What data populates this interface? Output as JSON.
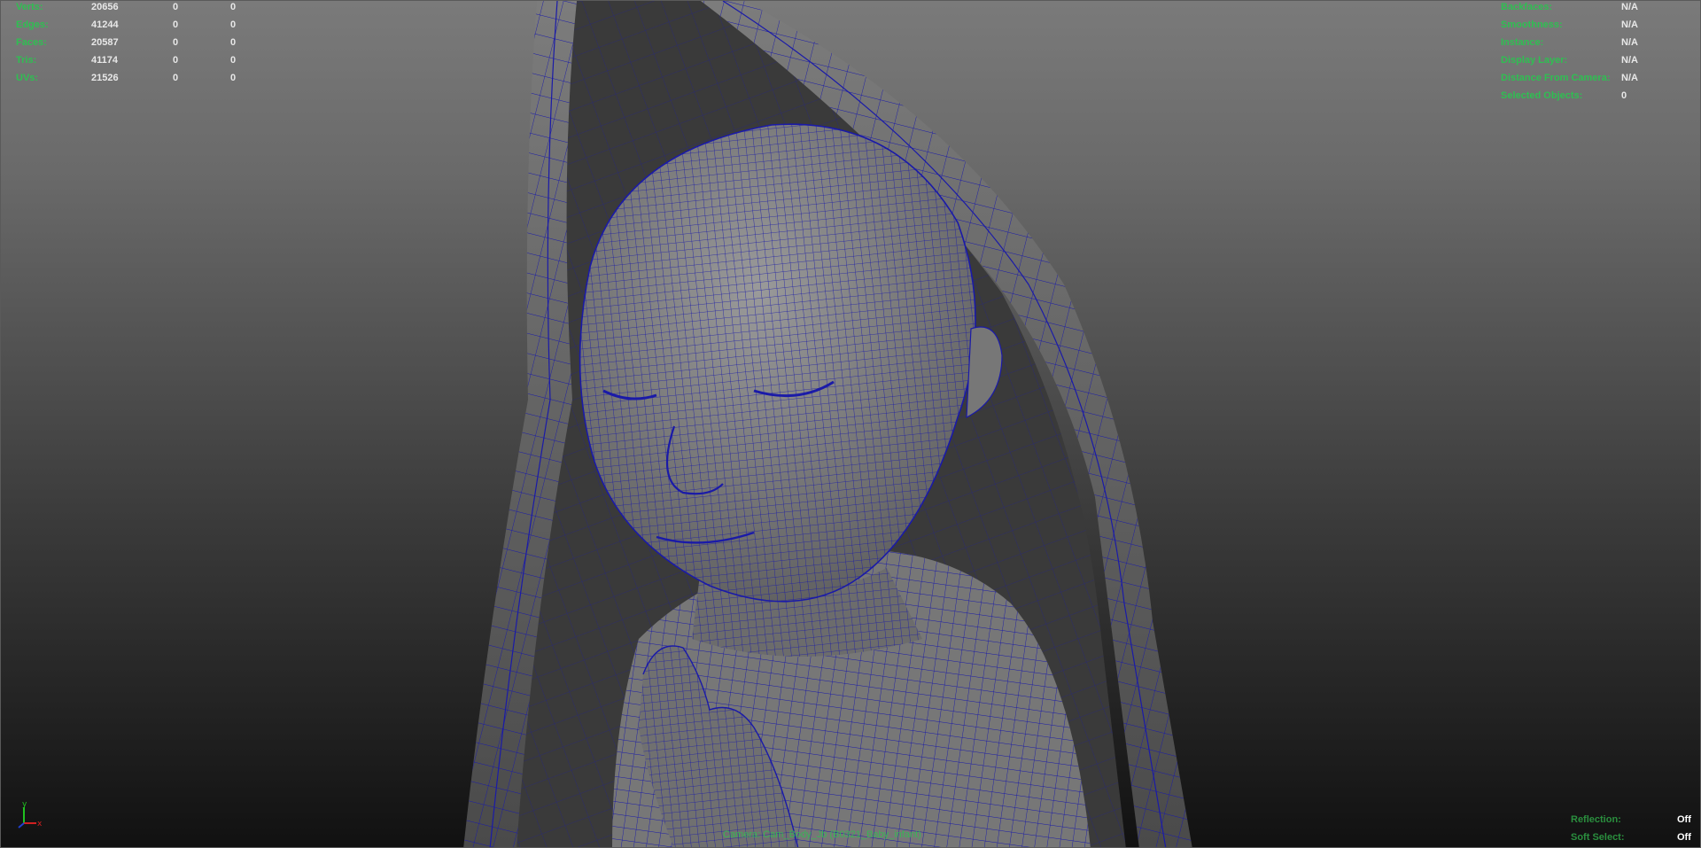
{
  "heads_up_left": {
    "rows": [
      {
        "label": "Verts:",
        "c1": "20656",
        "c2": "0",
        "c3": "0"
      },
      {
        "label": "Edges:",
        "c1": "41244",
        "c2": "0",
        "c3": "0"
      },
      {
        "label": "Faces:",
        "c1": "20587",
        "c2": "0",
        "c3": "0"
      },
      {
        "label": "Tris:",
        "c1": "41174",
        "c2": "0",
        "c3": "0"
      },
      {
        "label": "UVs:",
        "c1": "21526",
        "c2": "0",
        "c3": "0"
      }
    ]
  },
  "heads_up_right": {
    "rows": [
      {
        "label": "Backfaces:",
        "value": "N/A"
      },
      {
        "label": "Smoothness:",
        "value": "N/A"
      },
      {
        "label": "Instance:",
        "value": "N/A"
      },
      {
        "label": "Display Layer:",
        "value": "N/A"
      },
      {
        "label": "Distance From Camera:",
        "value": "N/A"
      },
      {
        "label": "Selected Objects:",
        "value": "0"
      }
    ]
  },
  "heads_up_bottom_right": {
    "rows": [
      {
        "label": "Reflection:",
        "value": "Off"
      },
      {
        "label": "Soft Select:",
        "value": "Off"
      }
    ]
  },
  "camera_label": "Camera: Cam_Body_Jb (B0321_Baby_infant)",
  "axis": {
    "x": "x",
    "y": "y",
    "z": "z"
  },
  "colors": {
    "hud_label": "#2fbf52",
    "hud_value": "#e8e8e8",
    "wireframe": "#1a1aa8",
    "mesh_fill": "#7f7f7f",
    "axis_x": "#d02020",
    "axis_y": "#20c020",
    "axis_z": "#2040d0"
  }
}
